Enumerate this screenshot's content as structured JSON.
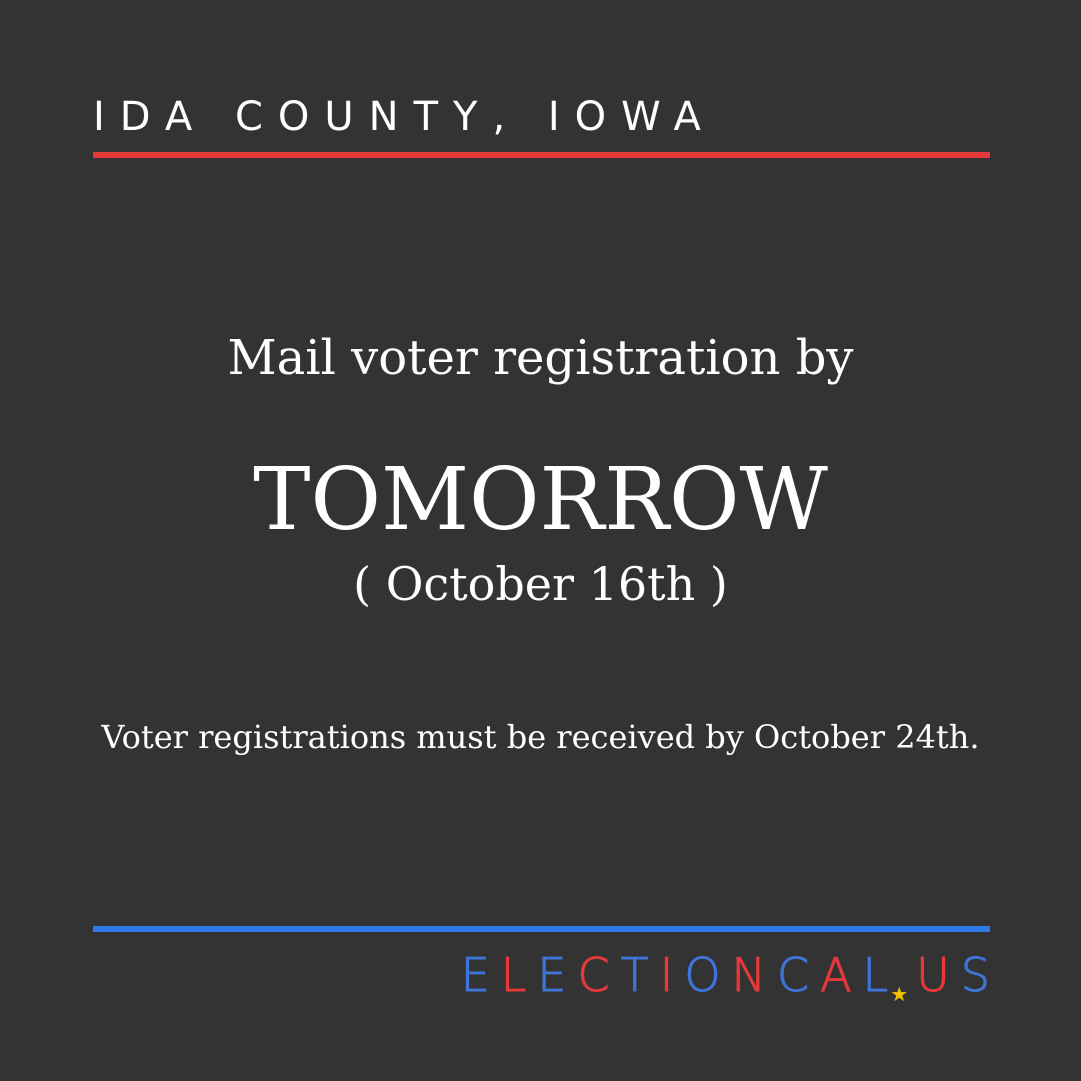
{
  "location": "IDA COUNTY, IOWA",
  "headline": "Mail voter registration by",
  "deadline": "TOMORROW",
  "deadline_date": "( October 16th )",
  "note": "Voter registrations must be received by October 24th.",
  "brand": {
    "letters": [
      "E",
      "L",
      "E",
      "C",
      "T",
      "I",
      "O",
      "N",
      "C",
      "A",
      "L",
      "★",
      "U",
      "S"
    ],
    "star_icon": "star-icon",
    "colors": {
      "red": "#e5393a",
      "blue": "#3f74d8",
      "yellow": "#f5c400"
    }
  },
  "colors": {
    "background": "#333333",
    "top_rule": "#e5393a",
    "bottom_rule": "#2f7bea",
    "text": "#ffffff"
  }
}
